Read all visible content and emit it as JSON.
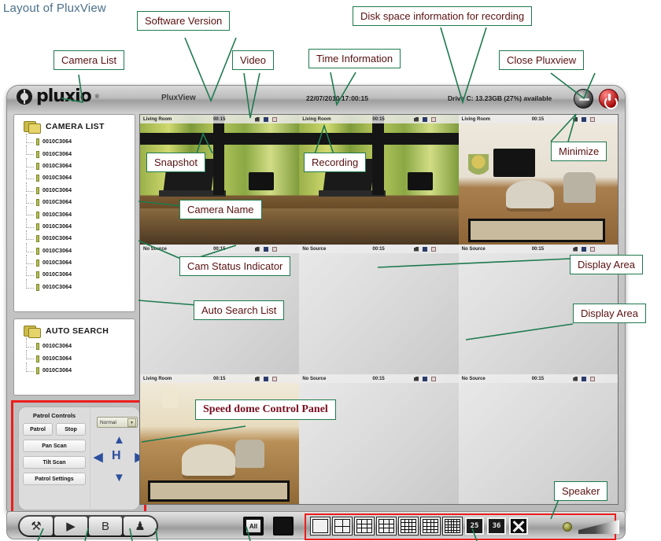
{
  "page": {
    "title": "Layout of PluxView"
  },
  "window": {
    "logo_text": "pluxio",
    "logo_tm": "®",
    "app_name": "PluxView",
    "time_info": "22/07/2010 17:00:15",
    "disk_info": "Drive C: 13.23GB (27%) available",
    "minimize_label": "minimize",
    "close_label": "close"
  },
  "sidebar": {
    "camera_list": {
      "header": "CAMERA LIST",
      "items": [
        "0010C3064",
        "0010C3064",
        "0010C3064",
        "0010C3064",
        "0010C3064",
        "0010C3064",
        "0010C3064",
        "0010C3064",
        "0010C3064",
        "0010C3064",
        "0010C3064",
        "0010C3064",
        "0010C3064"
      ]
    },
    "auto_search": {
      "header": "AUTO SEARCH",
      "items": [
        "0010C3064",
        "0010C3064",
        "0010C3064"
      ]
    }
  },
  "speed_dome": {
    "title": "Patrol Controls",
    "patrol_label": "Patrol",
    "stop_label": "Stop",
    "pan_scan_label": "Pan Scan",
    "tilt_scan_label": "Tilt Scan",
    "patrol_settings_label": "Patrol Settings",
    "speed_selected": "Normal",
    "caret": "▼",
    "center_label": "H",
    "arrow_up": "▲",
    "arrow_down": "▼",
    "arrow_left": "◀",
    "arrow_right": "▶"
  },
  "video_grid": {
    "cells": [
      {
        "name": "Living Room",
        "time": "00:15",
        "scene": "window"
      },
      {
        "name": "Living Room",
        "time": "00:15",
        "scene": "window"
      },
      {
        "name": "Living Room",
        "time": "00:15",
        "scene": "lounge"
      },
      {
        "name": "No Source",
        "time": "00:15",
        "scene": "blank"
      },
      {
        "name": "No Source",
        "time": "00:15",
        "scene": "blank"
      },
      {
        "name": "No Source",
        "time": "00:15",
        "scene": "blank"
      },
      {
        "name": "Living Room",
        "time": "00:15",
        "scene": "lounge3"
      },
      {
        "name": "No Source",
        "time": "00:15",
        "scene": "blank"
      },
      {
        "name": "No Source",
        "time": "00:15",
        "scene": "blank"
      }
    ],
    "icon_names": [
      "snapshot-icon",
      "speaker-icon",
      "record-icon"
    ]
  },
  "toolbar": {
    "buttons": [
      {
        "name": "settings-button",
        "glyph": "⚒"
      },
      {
        "name": "playback-button",
        "glyph": "▶"
      },
      {
        "name": "snapshot-archive-button",
        "glyph": "὚B"
      },
      {
        "name": "users-button",
        "glyph": "♟"
      }
    ],
    "all_label": "All",
    "layouts": [
      {
        "name": "layout-1",
        "cols": 1,
        "rows": 1,
        "label": ""
      },
      {
        "name": "layout-4",
        "cols": 2,
        "rows": 2,
        "label": ""
      },
      {
        "name": "layout-6",
        "cols": 3,
        "rows": 3,
        "label": ""
      },
      {
        "name": "layout-9",
        "cols": 3,
        "rows": 3,
        "label": ""
      },
      {
        "name": "layout-13",
        "cols": 4,
        "rows": 4,
        "label": ""
      },
      {
        "name": "layout-16",
        "cols": 4,
        "rows": 4,
        "label": ""
      },
      {
        "name": "layout-17",
        "cols": 5,
        "rows": 5,
        "label": ""
      },
      {
        "name": "layout-25",
        "cols": 0,
        "rows": 0,
        "label": "25"
      },
      {
        "name": "layout-36",
        "cols": 0,
        "rows": 0,
        "label": "36"
      }
    ],
    "fullscreen_name": "fullscreen-button"
  },
  "annotations": [
    {
      "id": "camera-list",
      "text": "Camera List"
    },
    {
      "id": "software-version",
      "text": "Software Version"
    },
    {
      "id": "video",
      "text": "Video"
    },
    {
      "id": "time-information",
      "text": "Time Information"
    },
    {
      "id": "disk-space",
      "text": "Disk space information for recording"
    },
    {
      "id": "close-pluxview",
      "text": "Close Pluxview"
    },
    {
      "id": "minimize",
      "text": "Minimize"
    },
    {
      "id": "snapshot",
      "text": "Snapshot"
    },
    {
      "id": "recording",
      "text": "Recording"
    },
    {
      "id": "camera-name",
      "text": "Camera Name"
    },
    {
      "id": "cam-status",
      "text": "Cam Status Indicator"
    },
    {
      "id": "display-area-1",
      "text": "Display Area"
    },
    {
      "id": "auto-search-list",
      "text": "Auto Search List"
    },
    {
      "id": "display-area-2",
      "text": "Display Area"
    },
    {
      "id": "speed-dome",
      "text": "Speed dome Control Panel"
    },
    {
      "id": "speaker",
      "text": "Speaker"
    }
  ],
  "colors": {
    "callout_border": "#1e7a4f",
    "callout_text": "#5a1010",
    "highlight_red": "#ee1c1c",
    "heading": "#4a6f8a"
  }
}
